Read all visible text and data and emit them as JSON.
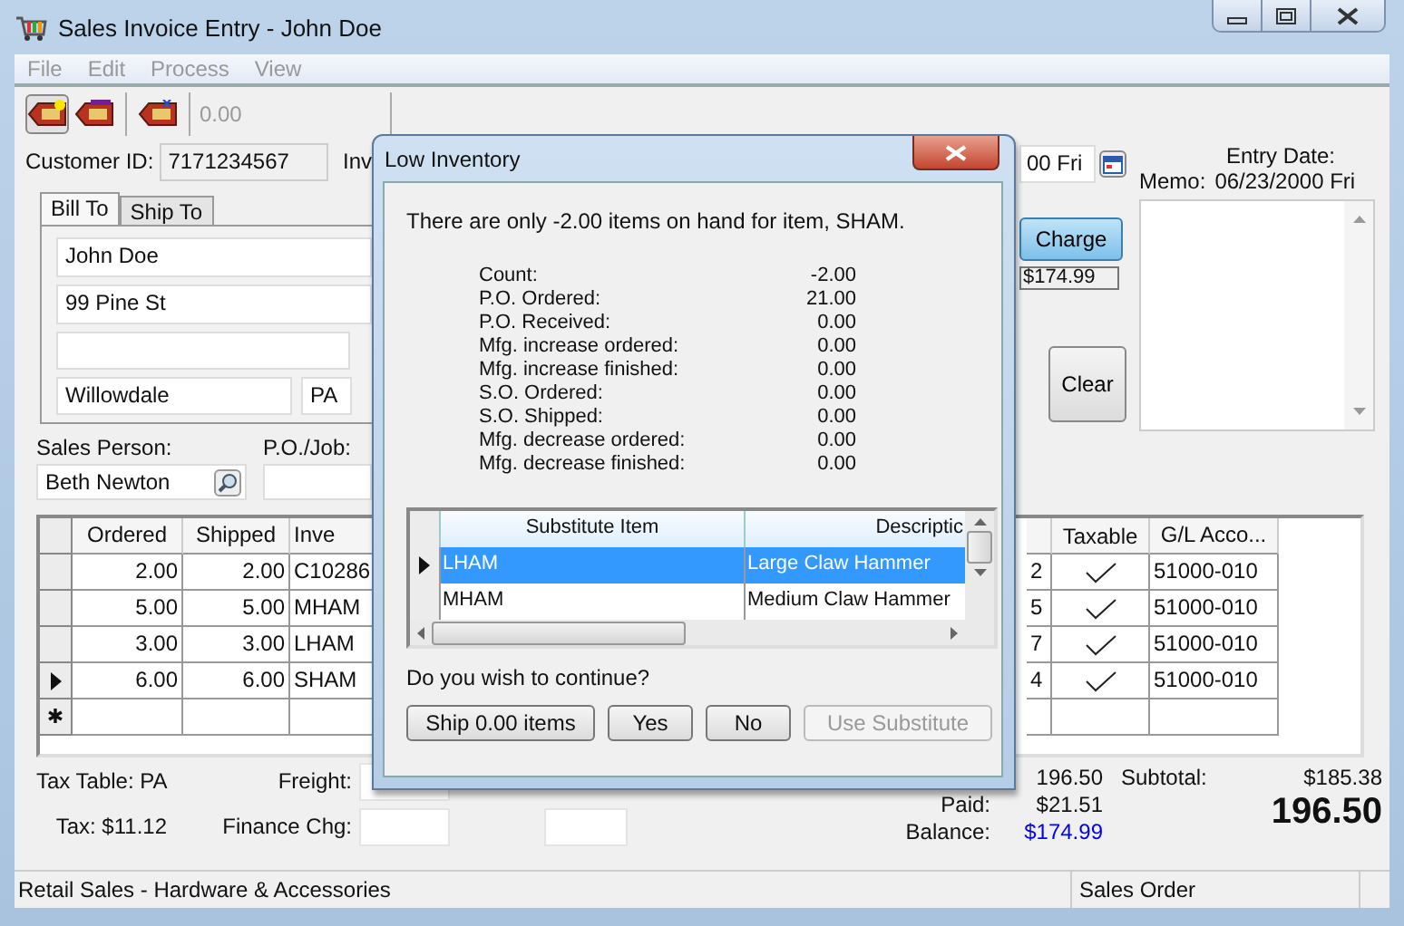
{
  "window": {
    "title": "Sales Invoice Entry - John Doe"
  },
  "menu": [
    "File",
    "Edit",
    "Process",
    "View"
  ],
  "toolbar": {
    "amount": "0.00"
  },
  "customer": {
    "label": "Customer ID:",
    "value": "7171234567",
    "next_label": "Inv"
  },
  "address_tabs": [
    {
      "label": "Bill To",
      "selected": true
    },
    {
      "label": "Ship To",
      "selected": false
    }
  ],
  "address": {
    "name": "John Doe",
    "street": "99 Pine St",
    "city": "Willowdale",
    "state": "PA"
  },
  "sales_person": {
    "label": "Sales Person:",
    "value": "Beth Newton"
  },
  "po_job": {
    "label": "P.O./Job:"
  },
  "date_field": {
    "value": "00 Fri"
  },
  "charge_button": "Charge",
  "charge_amount": "$174.99",
  "clear_button": "Clear",
  "entry_date": {
    "label": "Entry Date:",
    "memo_label": "Memo:",
    "value": "06/23/2000 Fri"
  },
  "lines": {
    "columns_left": [
      "Ordered",
      "Shipped",
      "Inve"
    ],
    "columns_right": [
      "Taxable",
      "G/L Acco..."
    ],
    "rows": [
      {
        "ordered": "2.00",
        "shipped": "2.00",
        "item": "C10286",
        "column_fragment": "2",
        "taxable": true,
        "gl_account": "51000-010",
        "current": false
      },
      {
        "ordered": "5.00",
        "shipped": "5.00",
        "item": "MHAM",
        "column_fragment": "5",
        "taxable": true,
        "gl_account": "51000-010",
        "current": false
      },
      {
        "ordered": "3.00",
        "shipped": "3.00",
        "item": "LHAM",
        "column_fragment": "7",
        "taxable": true,
        "gl_account": "51000-010",
        "current": false
      },
      {
        "ordered": "6.00",
        "shipped": "6.00",
        "item": "SHAM",
        "column_fragment": "4",
        "taxable": true,
        "gl_account": "51000-010",
        "current": true
      }
    ],
    "new_row_marker": "✱"
  },
  "totals": {
    "tax_table": "Tax Table: PA",
    "freight_label": "Freight:",
    "tax": "Tax: $11.12",
    "finance_label": "Finance Chg:",
    "total_fragment": "196.50",
    "paid_label": "Paid:",
    "paid": "$21.51",
    "balance_label": "Balance:",
    "balance": "$174.99",
    "subtotal_label": "Subtotal:",
    "subtotal": "$185.38",
    "grand_total": "196.50"
  },
  "status_bar": [
    "Retail Sales - Hardware & Accessories",
    "Sales Order"
  ],
  "dialog": {
    "title": "Low Inventory",
    "message": "There are only -2.00 items on hand for item, SHAM.",
    "stats": [
      {
        "label": "Count:",
        "value": "-2.00"
      },
      {
        "label": "P.O. Ordered:",
        "value": "21.00"
      },
      {
        "label": "P.O. Received:",
        "value": "0.00"
      },
      {
        "label": "Mfg. increase ordered:",
        "value": "0.00"
      },
      {
        "label": "Mfg. increase finished:",
        "value": "0.00"
      },
      {
        "label": "S.O. Ordered:",
        "value": "0.00"
      },
      {
        "label": "S.O. Shipped:",
        "value": "0.00"
      },
      {
        "label": "Mfg. decrease ordered:",
        "value": "0.00"
      },
      {
        "label": "Mfg. decrease finished:",
        "value": "0.00"
      }
    ],
    "substitutes": {
      "columns": [
        "Substitute Item",
        "Descriptic"
      ],
      "rows": [
        {
          "item": "LHAM",
          "description": "Large Claw Hammer",
          "selected": true
        },
        {
          "item": "MHAM",
          "description": "Medium Claw Hammer",
          "selected": false
        }
      ]
    },
    "question": "Do you wish to continue?",
    "buttons": [
      {
        "label": "Ship 0.00 items",
        "disabled": false
      },
      {
        "label": "Yes",
        "disabled": false
      },
      {
        "label": "No",
        "disabled": false
      },
      {
        "label": "Use Substitute",
        "disabled": true
      }
    ]
  }
}
